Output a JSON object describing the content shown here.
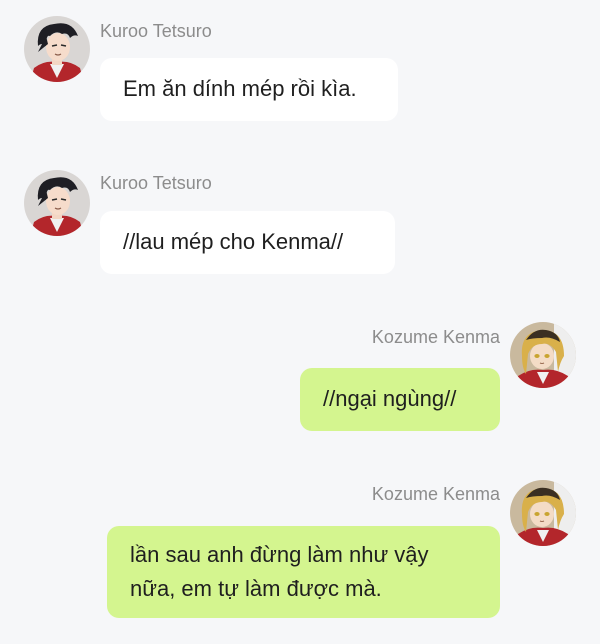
{
  "messages": [
    {
      "sender": "Kuroo Tetsuro",
      "text": "Em ăn dính mép rồi kìa.",
      "side": "left",
      "avatar_icon": "kuroo-avatar"
    },
    {
      "sender": "Kuroo Tetsuro",
      "text": "//lau mép cho Kenma//",
      "side": "left",
      "avatar_icon": "kuroo-avatar"
    },
    {
      "sender": "Kozume Kenma",
      "text": "//ngại ngùng//",
      "side": "right",
      "avatar_icon": "kenma-avatar"
    },
    {
      "sender": "Kozume Kenma",
      "text": "lần sau anh đừng làm như vậy nữa, em tự làm được mà.",
      "side": "right",
      "avatar_icon": "kenma-avatar"
    }
  ],
  "colors": {
    "background": "#f6f7f9",
    "left_bubble": "#ffffff",
    "right_bubble": "#d4f58f",
    "name_text": "#8c8c8c",
    "message_text": "#1f1f1f"
  }
}
